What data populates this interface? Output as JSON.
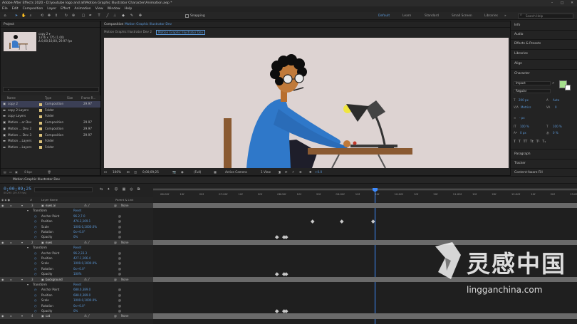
{
  "title_bar": {
    "text": "Adobe After Effects 2020 - D:\\youtube logo and all\\Motion Graphic Illustrator Character\\Animation.aep *"
  },
  "menu": [
    "File",
    "Edit",
    "Composition",
    "Layer",
    "Effect",
    "Animation",
    "View",
    "Window",
    "Help"
  ],
  "toolbar": {
    "snapping_label": "Snapping",
    "workspaces": [
      "Default",
      "Learn",
      "Standard",
      "Small Screen",
      "Libraries"
    ],
    "active_workspace": "Default",
    "search_placeholder": "Search Help"
  },
  "project": {
    "tab": "Project",
    "selected_name": "copy 2 ▾",
    "selected_info": [
      "1376 x 775 (1.00)",
      "Δ 0;00;10;00, 29.97 fps"
    ],
    "columns": [
      "Name",
      "Type",
      "Size",
      "Frame R..."
    ],
    "items": [
      {
        "name": "copy 2",
        "type": "Composition",
        "fps": "29.97",
        "color": "#d9c07a",
        "selected": true
      },
      {
        "name": "copy 2 Layers",
        "type": "Folder",
        "fps": "",
        "color": "#d9c07a"
      },
      {
        "name": "copy Layers",
        "type": "Folder",
        "fps": "",
        "color": "#d9c07a"
      },
      {
        "name": "Motion ...or Dev",
        "type": "Composition",
        "fps": "29.97",
        "color": "#d9c07a"
      },
      {
        "name": "Motion ... Dev 2",
        "type": "Composition",
        "fps": "29.97",
        "color": "#d9c07a"
      },
      {
        "name": "Motion ... Dev 3",
        "type": "Composition",
        "fps": "29.97",
        "color": "#d9c07a"
      },
      {
        "name": "Motion ...Layers",
        "type": "Folder",
        "fps": "",
        "color": "#d9c07a"
      },
      {
        "name": "Motion ...Layers",
        "type": "Folder",
        "fps": "",
        "color": "#d9c07a"
      }
    ],
    "footer_bpc": "8 bpc"
  },
  "viewer": {
    "tab_prefix": "Composition",
    "tab_link": "Motion Graphic Illustrator Dev",
    "crumbs": [
      "Motion Graphic Illustrator Dev 2",
      "Motion Graphic Illustrator Dev"
    ],
    "active_crumb": "Motion Graphic Illustrator Dev",
    "controls": {
      "zoom": "100%",
      "time": "0;00;09;25",
      "quality": "(Full)",
      "camera": "Active Camera",
      "view": "1 View",
      "exposure": "+0.0"
    }
  },
  "right_panels": {
    "tabs": [
      "Info",
      "Audio",
      "Effects & Presets",
      "Libraries",
      "Align",
      "Character"
    ],
    "character": {
      "font": "Impact",
      "style": "Regular",
      "size": "200 px",
      "leading": "Auto",
      "tracking_label": "Metrics",
      "tracking": "0",
      "stroke": "- px",
      "vscale": "100 %",
      "hscale": "100 %",
      "baseline": "0 px",
      "tsume": "0 %"
    },
    "bottom_tabs": [
      "Paragraph",
      "Tracker",
      "Content-Aware Fill"
    ],
    "fill_color": "#a6e08d",
    "stroke_color": "#ffffff"
  },
  "timeline": {
    "tab": "Motion Graphic Illustrator Dev",
    "timecode": "0;00;09;25",
    "frame_info": "00295 (29.97 fps)",
    "columns": [
      "#",
      "Layer Name",
      "Parent & Link"
    ],
    "ruler": [
      "06:00f",
      "10f",
      "20f",
      "07:00f",
      "10f",
      "20f",
      "08:00f",
      "10f",
      "20f",
      "09:00f",
      "10f",
      "20f",
      "10:00f",
      "10f",
      "20f",
      "11:00f",
      "10f",
      "20f",
      "12:00f",
      "10f",
      "20f",
      "13:00f"
    ],
    "layers": [
      {
        "index": "3",
        "name": "eyes.ai",
        "parent": "None",
        "props": [
          {
            "name": "Transform",
            "value": "Reset"
          },
          {
            "name": "Anchor Point",
            "value": "96.2,7.0"
          },
          {
            "name": "Position",
            "value": "476.3,169.1"
          },
          {
            "name": "Scale",
            "value": "1000.0,1000.0%"
          },
          {
            "name": "Rotation",
            "value": "0x+0.0°"
          },
          {
            "name": "Opacity",
            "value": "0%"
          }
        ]
      },
      {
        "index": "2",
        "name": "eyes",
        "parent": "None",
        "props": [
          {
            "name": "Transform",
            "value": "Reset"
          },
          {
            "name": "Anchor Point",
            "value": "96.2,33.3"
          },
          {
            "name": "Position",
            "value": "427.1,166.4"
          },
          {
            "name": "Scale",
            "value": "1000.0,1000.0%"
          },
          {
            "name": "Rotation",
            "value": "0x+0.0°"
          },
          {
            "name": "Opacity",
            "value": "100%"
          }
        ]
      },
      {
        "index": "3",
        "name": "background",
        "parent": "None",
        "props": [
          {
            "name": "Transform",
            "value": "Reset"
          },
          {
            "name": "Anchor Point",
            "value": "688.0,389.0"
          },
          {
            "name": "Position",
            "value": "688.0,389.0"
          },
          {
            "name": "Scale",
            "value": "1000.0,1000.0%"
          },
          {
            "name": "Rotation",
            "value": "0x+0.0°"
          },
          {
            "name": "Opacity",
            "value": "0%"
          }
        ]
      },
      {
        "index": "4",
        "name": "cat",
        "parent": "None",
        "props": []
      }
    ]
  },
  "watermark": {
    "cn": "灵感中国",
    "url": "lingganchina.com"
  }
}
